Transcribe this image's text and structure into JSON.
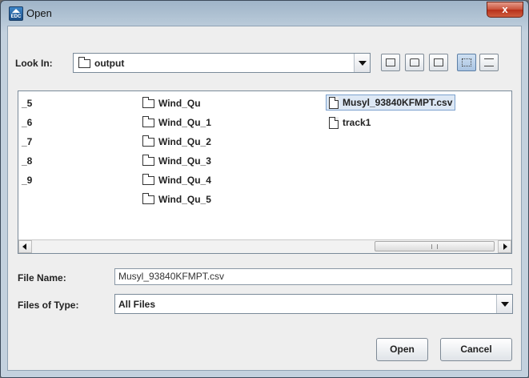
{
  "window": {
    "title": "Open",
    "app_icon_text": "EDC"
  },
  "look_in": {
    "label": "Look In:",
    "value": "output"
  },
  "toolbar": {
    "icons": [
      "up-one-level-icon",
      "home-icon",
      "new-folder-icon",
      "list-view-icon",
      "details-view-icon"
    ]
  },
  "files": {
    "col1": [
      "_5",
      "_6",
      "_7",
      "_8",
      "_9"
    ],
    "col2": [
      "Wind_Qu",
      "Wind_Qu_1",
      "Wind_Qu_2",
      "Wind_Qu_3",
      "Wind_Qu_4",
      "Wind_Qu_5"
    ],
    "col3": [
      "Musyl_93840KFMPT.csv",
      "track1"
    ],
    "selected": "Musyl_93840KFMPT.csv"
  },
  "file_name": {
    "label": "File Name:",
    "value": "Musyl_93840KFMPT.csv"
  },
  "file_type": {
    "label": "Files of Type:",
    "value": "All Files"
  },
  "buttons": {
    "open": "Open",
    "cancel": "Cancel"
  },
  "close_glyph": "x"
}
